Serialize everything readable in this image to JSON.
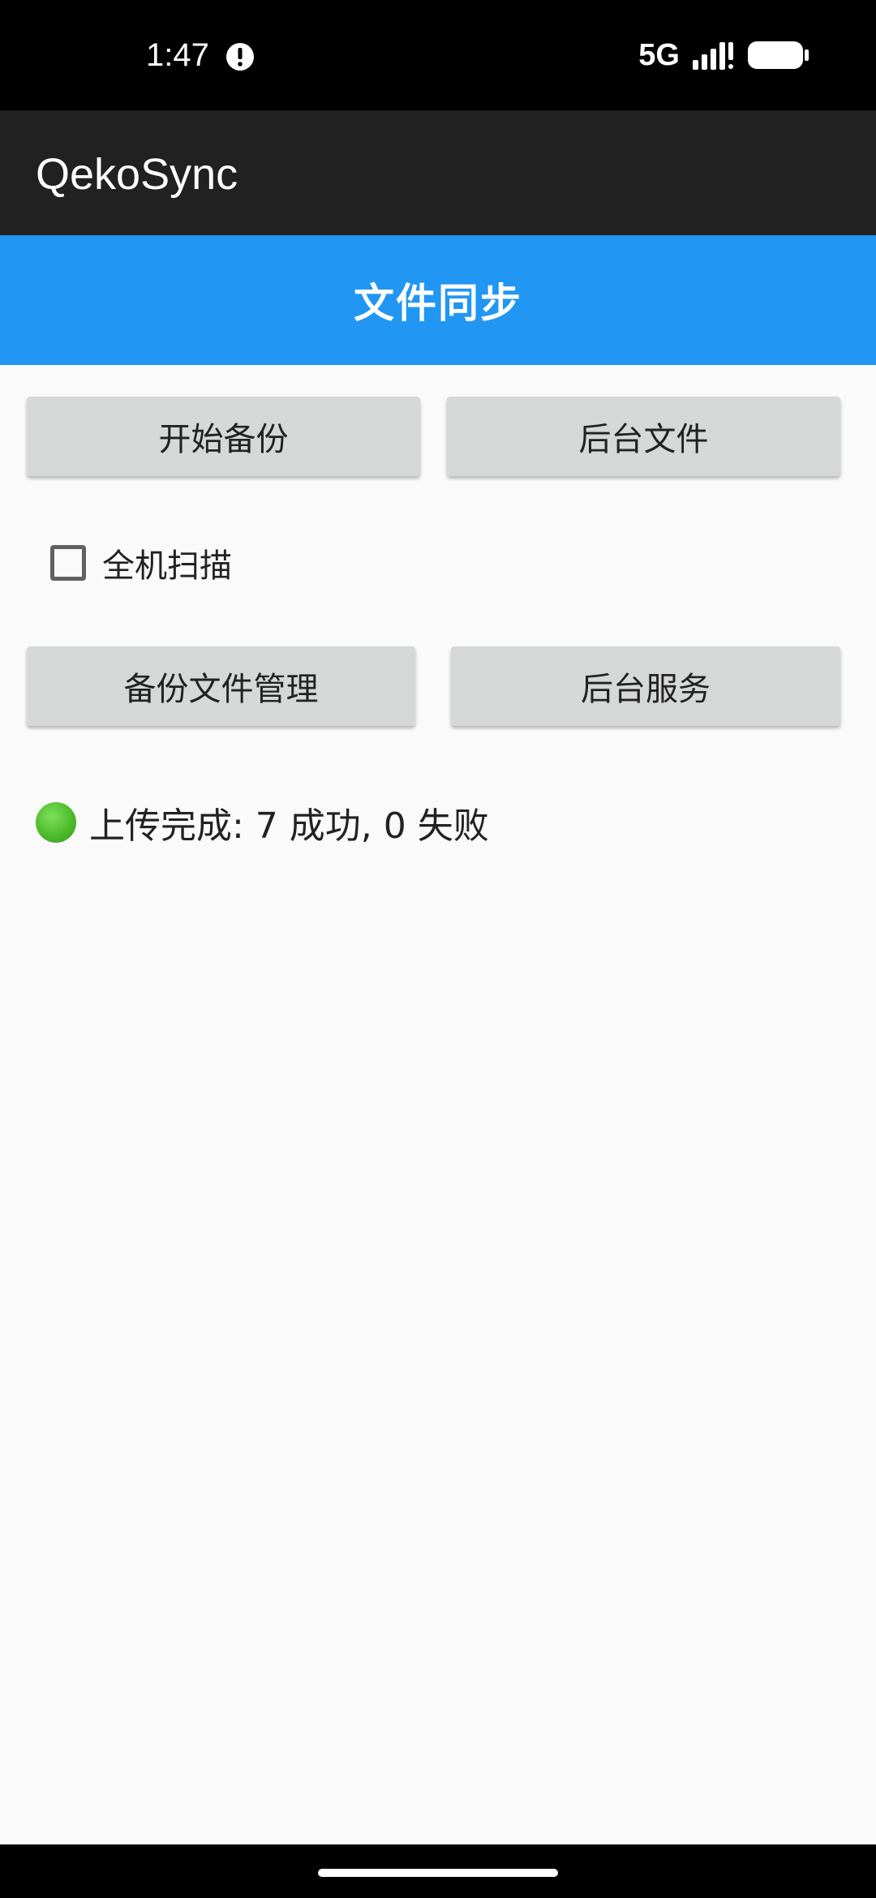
{
  "status_bar": {
    "time": "1:47",
    "network": "5G",
    "icons": [
      "alert-icon",
      "signal-icon",
      "battery-icon"
    ]
  },
  "app_bar": {
    "title": "QekoSync"
  },
  "header": {
    "title": "文件同步",
    "color": "#2196f3"
  },
  "actions": {
    "start_backup": "开始备份",
    "background_files": "后台文件",
    "backup_file_management": "备份文件管理",
    "background_service": "后台服务"
  },
  "options": {
    "full_scan_label": "全机扫描",
    "full_scan_checked": false
  },
  "status": {
    "icon": "green-circle-icon",
    "message": "上传完成: 7 成功, 0 失败",
    "color": "#4cbb2a"
  }
}
